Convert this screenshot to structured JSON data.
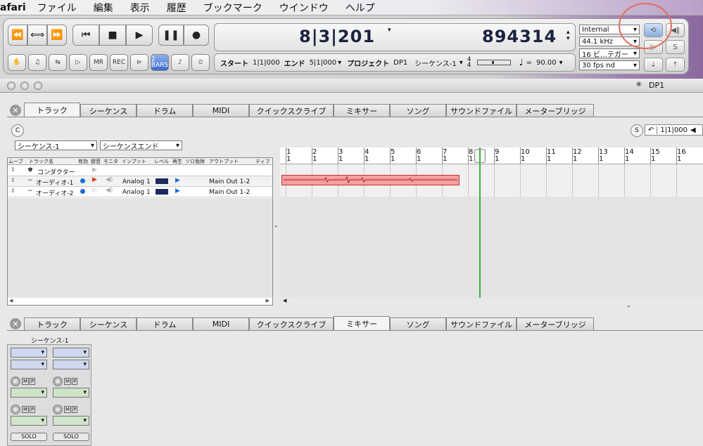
{
  "menubar": {
    "app": "afari",
    "items": [
      "ファイル",
      "編集",
      "表示",
      "履歴",
      "ブックマーク",
      "ウインドウ",
      "ヘルプ"
    ]
  },
  "transport": {
    "buttons": [
      "⏪",
      "⟺",
      "⏩",
      "⏮",
      "■",
      "▶",
      "❚❚",
      "●"
    ],
    "small_buttons": [
      "✋",
      "♫",
      "⇆",
      "▷",
      "MR",
      "REC",
      "⊳",
      "2 BARS",
      "♪",
      "⏲"
    ],
    "counter_main": "8|3|201",
    "counter_samples": "894314",
    "info": {
      "start_label": "スタート",
      "start": "1|1|000",
      "end_label": "エンド",
      "end": "5|1|000",
      "project_label": "プロジェクト",
      "project": "DP1",
      "sequence": "シーケンス-1",
      "time_sig_top": "4",
      "time_sig_bottom": "4",
      "tempo": "90.00"
    },
    "sync_source": "Internal",
    "sample_rate": "44.1 kHz",
    "bit_depth": "16 ビ…テガー",
    "fps": "30 fps nd"
  },
  "window": {
    "title": "DP1"
  },
  "tabs": [
    "トラック",
    "シーケンス",
    "ドラム",
    "MIDI",
    "クイックスクライブ",
    "ミキサー",
    "ソング",
    "サウンドファイル",
    "メーターブリッジ"
  ],
  "tracks_panel": {
    "seq_select": "シーケンス-1",
    "end_select": "シーケンスエンド",
    "headers": [
      "ムーブ",
      "トラック名",
      "有効",
      "録音",
      "モニタ",
      "インプット",
      "レベル",
      "再生",
      "ソロ免除",
      "アウトプット",
      "ティフ"
    ],
    "rows": [
      {
        "name": "コンダクター",
        "input": "",
        "output": ""
      },
      {
        "name": "オーディオ-1",
        "input": "Analog 1",
        "output": "Main Out 1-2"
      },
      {
        "name": "オーディオ-2",
        "input": "Analog 1",
        "output": "Main Out 1-2"
      }
    ],
    "counter": "1|1|000"
  },
  "ruler": [
    "1",
    "2",
    "3",
    "4",
    "5",
    "6",
    "7",
    "8",
    "9",
    "10",
    "11",
    "12",
    "13",
    "14",
    "15",
    "16"
  ],
  "mixer": {
    "strip_label": "シーケンス-1",
    "solo": "SOLO",
    "m": "M",
    "p": "P"
  },
  "colors": {
    "region": "#f5a0a0",
    "playhead": "#3cb043",
    "selection_circle": "#e07060"
  }
}
